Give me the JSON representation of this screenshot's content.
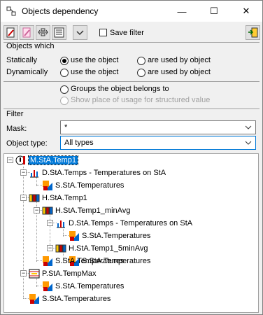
{
  "window": {
    "title": "Objects dependency",
    "minimize": "—",
    "maximize": "☐",
    "close": "✕"
  },
  "toolbar": {
    "filter_label": "Save filter"
  },
  "objects_which": {
    "header": "Objects which",
    "statically": "Statically",
    "dynamically": "Dynamically",
    "use_object": "use the object",
    "used_by": "are used by object",
    "groups": "Groups the object belongs to",
    "show_place": "Show place of usage for structured value"
  },
  "filter": {
    "header": "Filter",
    "mask_label": "Mask:",
    "mask_value": "*",
    "type_label": "Object type:",
    "type_value": "All types"
  },
  "tree": [
    {
      "label": "M.StA.Temp1",
      "icon": "user-object-icon"
    },
    {
      "label": "D.StA.Temps - Temperatures on StA",
      "icon": "display-icon"
    },
    {
      "label": "S.StA.Temperatures",
      "icon": "scheme-icon"
    },
    {
      "label": "H.StA.Temp1",
      "icon": "archive-icon"
    },
    {
      "label": "H.StA.Temp1_minAvg",
      "icon": "archive-icon"
    },
    {
      "label": "D.StA.Temps - Temperatures on StA",
      "icon": "display-icon"
    },
    {
      "label": "S.StA.Temperatures",
      "icon": "scheme-icon"
    },
    {
      "label": "H.StA.Temp1_5minAvg",
      "icon": "archive-icon"
    },
    {
      "label": "S.StA.Temperatures",
      "icon": "scheme-icon"
    },
    {
      "label": "S.StA.Temperatures",
      "icon": "scheme-icon"
    },
    {
      "label": "P.StA.TempMax",
      "icon": "process-icon"
    },
    {
      "label": "S.StA.Temperatures",
      "icon": "scheme-icon"
    },
    {
      "label": "S.StA.Temperatures",
      "icon": "scheme-icon"
    }
  ]
}
